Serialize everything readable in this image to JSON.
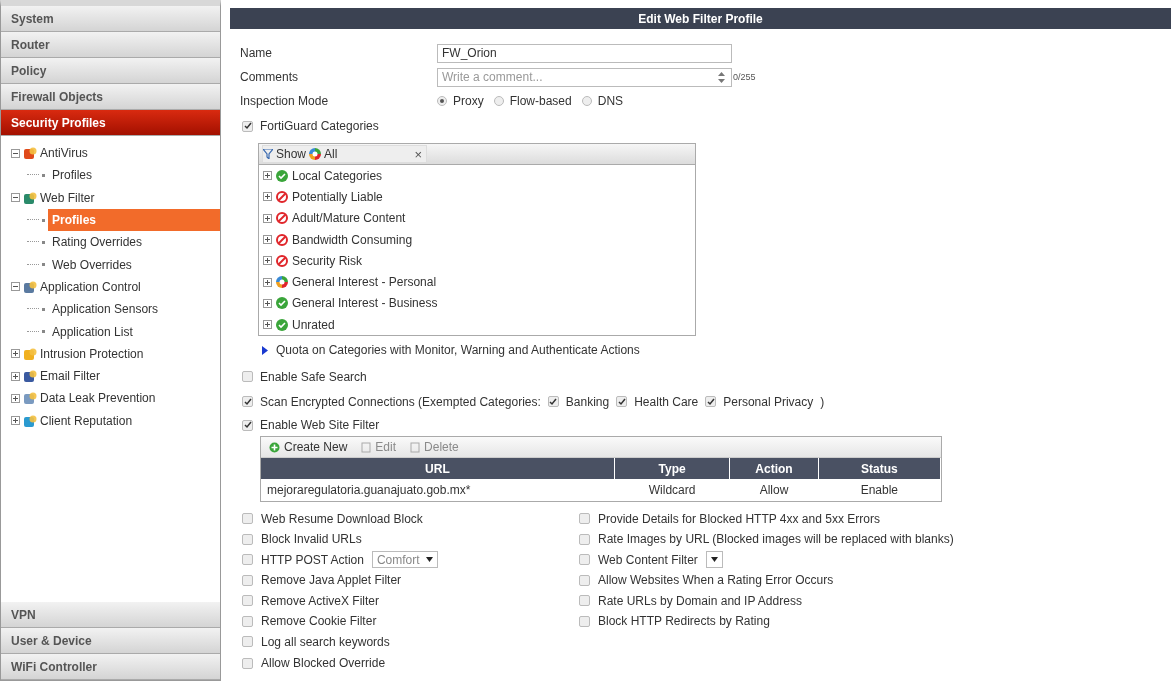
{
  "sidebar": {
    "sections_top": [
      {
        "label": "System",
        "selected": false
      },
      {
        "label": "Router",
        "selected": false
      },
      {
        "label": "Policy",
        "selected": false
      },
      {
        "label": "Firewall Objects",
        "selected": false
      },
      {
        "label": "Security Profiles",
        "selected": true
      }
    ],
    "tree": [
      {
        "label": "AntiVirus",
        "expanded": true,
        "children": [
          {
            "label": "Profiles",
            "selected": false
          }
        ]
      },
      {
        "label": "Web Filter",
        "expanded": true,
        "children": [
          {
            "label": "Profiles",
            "selected": true
          },
          {
            "label": "Rating Overrides",
            "selected": false
          },
          {
            "label": "Web Overrides",
            "selected": false
          }
        ]
      },
      {
        "label": "Application Control",
        "expanded": true,
        "children": [
          {
            "label": "Application Sensors",
            "selected": false
          },
          {
            "label": "Application List",
            "selected": false
          }
        ]
      },
      {
        "label": "Intrusion Protection",
        "expanded": false
      },
      {
        "label": "Email Filter",
        "expanded": false
      },
      {
        "label": "Data Leak Prevention",
        "expanded": false
      },
      {
        "label": "Client Reputation",
        "expanded": false
      }
    ],
    "sections_bottom": [
      {
        "label": "VPN",
        "selected": false
      },
      {
        "label": "User & Device",
        "selected": false
      },
      {
        "label": "WiFi Controller",
        "selected": false
      }
    ]
  },
  "panel_title": "Edit Web Filter Profile",
  "name": {
    "label": "Name",
    "value": "FW_Orion"
  },
  "comments": {
    "label": "Comments",
    "placeholder": "Write a comment...",
    "counter": "0/255"
  },
  "inspection_mode": {
    "label": "Inspection Mode",
    "options": [
      {
        "label": "Proxy",
        "selected": true
      },
      {
        "label": "Flow-based",
        "selected": false
      },
      {
        "label": "DNS",
        "selected": false
      }
    ]
  },
  "fortiguard": {
    "label": "FortiGuard Categories",
    "checked": true,
    "filter": {
      "show": "Show",
      "value": "All",
      "clear": "×"
    },
    "categories": [
      {
        "label": "Local Categories",
        "kind": "allow"
      },
      {
        "label": "Potentially Liable",
        "kind": "block"
      },
      {
        "label": "Adult/Mature Content",
        "kind": "block"
      },
      {
        "label": "Bandwidth Consuming",
        "kind": "block"
      },
      {
        "label": "Security Risk",
        "kind": "block"
      },
      {
        "label": "General Interest - Personal",
        "kind": "mixed"
      },
      {
        "label": "General Interest - Business",
        "kind": "allow"
      },
      {
        "label": "Unrated",
        "kind": "allow"
      }
    ],
    "quota": {
      "label": "Quota on Categories with Monitor, Warning and Authenticate Actions",
      "expanded": false
    }
  },
  "safe_search": {
    "label": "Enable Safe Search",
    "checked": false
  },
  "scan_encrypted": {
    "label": "Scan Encrypted Connections (Exempted Categories:",
    "checked": true,
    "close": ")",
    "exempted": [
      {
        "label": "Banking",
        "checked": true
      },
      {
        "label": "Health Care",
        "checked": true
      },
      {
        "label": "Personal Privacy",
        "checked": true
      }
    ]
  },
  "web_site_filter": {
    "label": "Enable Web Site Filter",
    "checked": true,
    "toolbar": [
      {
        "label": "Create New",
        "disabled": false
      },
      {
        "label": "Edit",
        "disabled": true
      },
      {
        "label": "Delete",
        "disabled": true
      }
    ],
    "columns": [
      "URL",
      "Type",
      "Action",
      "Status"
    ],
    "rows": [
      [
        "mejoraregulatoria.guanajuato.gob.mx*",
        "Wildcard",
        "Allow",
        "Enable"
      ]
    ]
  },
  "options_left": [
    {
      "kind": "checkbox",
      "label": "Web Resume Download Block",
      "checked": false
    },
    {
      "kind": "checkbox",
      "label": "Block Invalid URLs",
      "checked": false
    },
    {
      "kind": "select",
      "label": "HTTP POST Action",
      "checked": false,
      "value": "Comfort"
    },
    {
      "kind": "checkbox",
      "label": "Remove Java Applet Filter",
      "checked": false
    },
    {
      "kind": "checkbox",
      "label": "Remove ActiveX Filter",
      "checked": false
    },
    {
      "kind": "checkbox",
      "label": "Remove Cookie Filter",
      "checked": false
    },
    {
      "kind": "checkbox",
      "label": "Log all search keywords",
      "checked": false
    },
    {
      "kind": "checkbox",
      "label": "Allow Blocked Override",
      "checked": false
    }
  ],
  "options_right": [
    {
      "kind": "checkbox",
      "label": "Provide Details for Blocked HTTP 4xx and 5xx Errors",
      "checked": false
    },
    {
      "kind": "checkbox",
      "label": "Rate Images by URL (Blocked images will be replaced with blanks)",
      "checked": false
    },
    {
      "kind": "select",
      "label": "Web Content Filter",
      "checked": false
    },
    {
      "kind": "checkbox",
      "label": "Allow Websites When a Rating Error Occurs",
      "checked": false
    },
    {
      "kind": "checkbox",
      "label": "Rate URLs by Domain and IP Address",
      "checked": false
    },
    {
      "kind": "checkbox",
      "label": "Block HTTP Redirects by Rating",
      "checked": false
    }
  ]
}
